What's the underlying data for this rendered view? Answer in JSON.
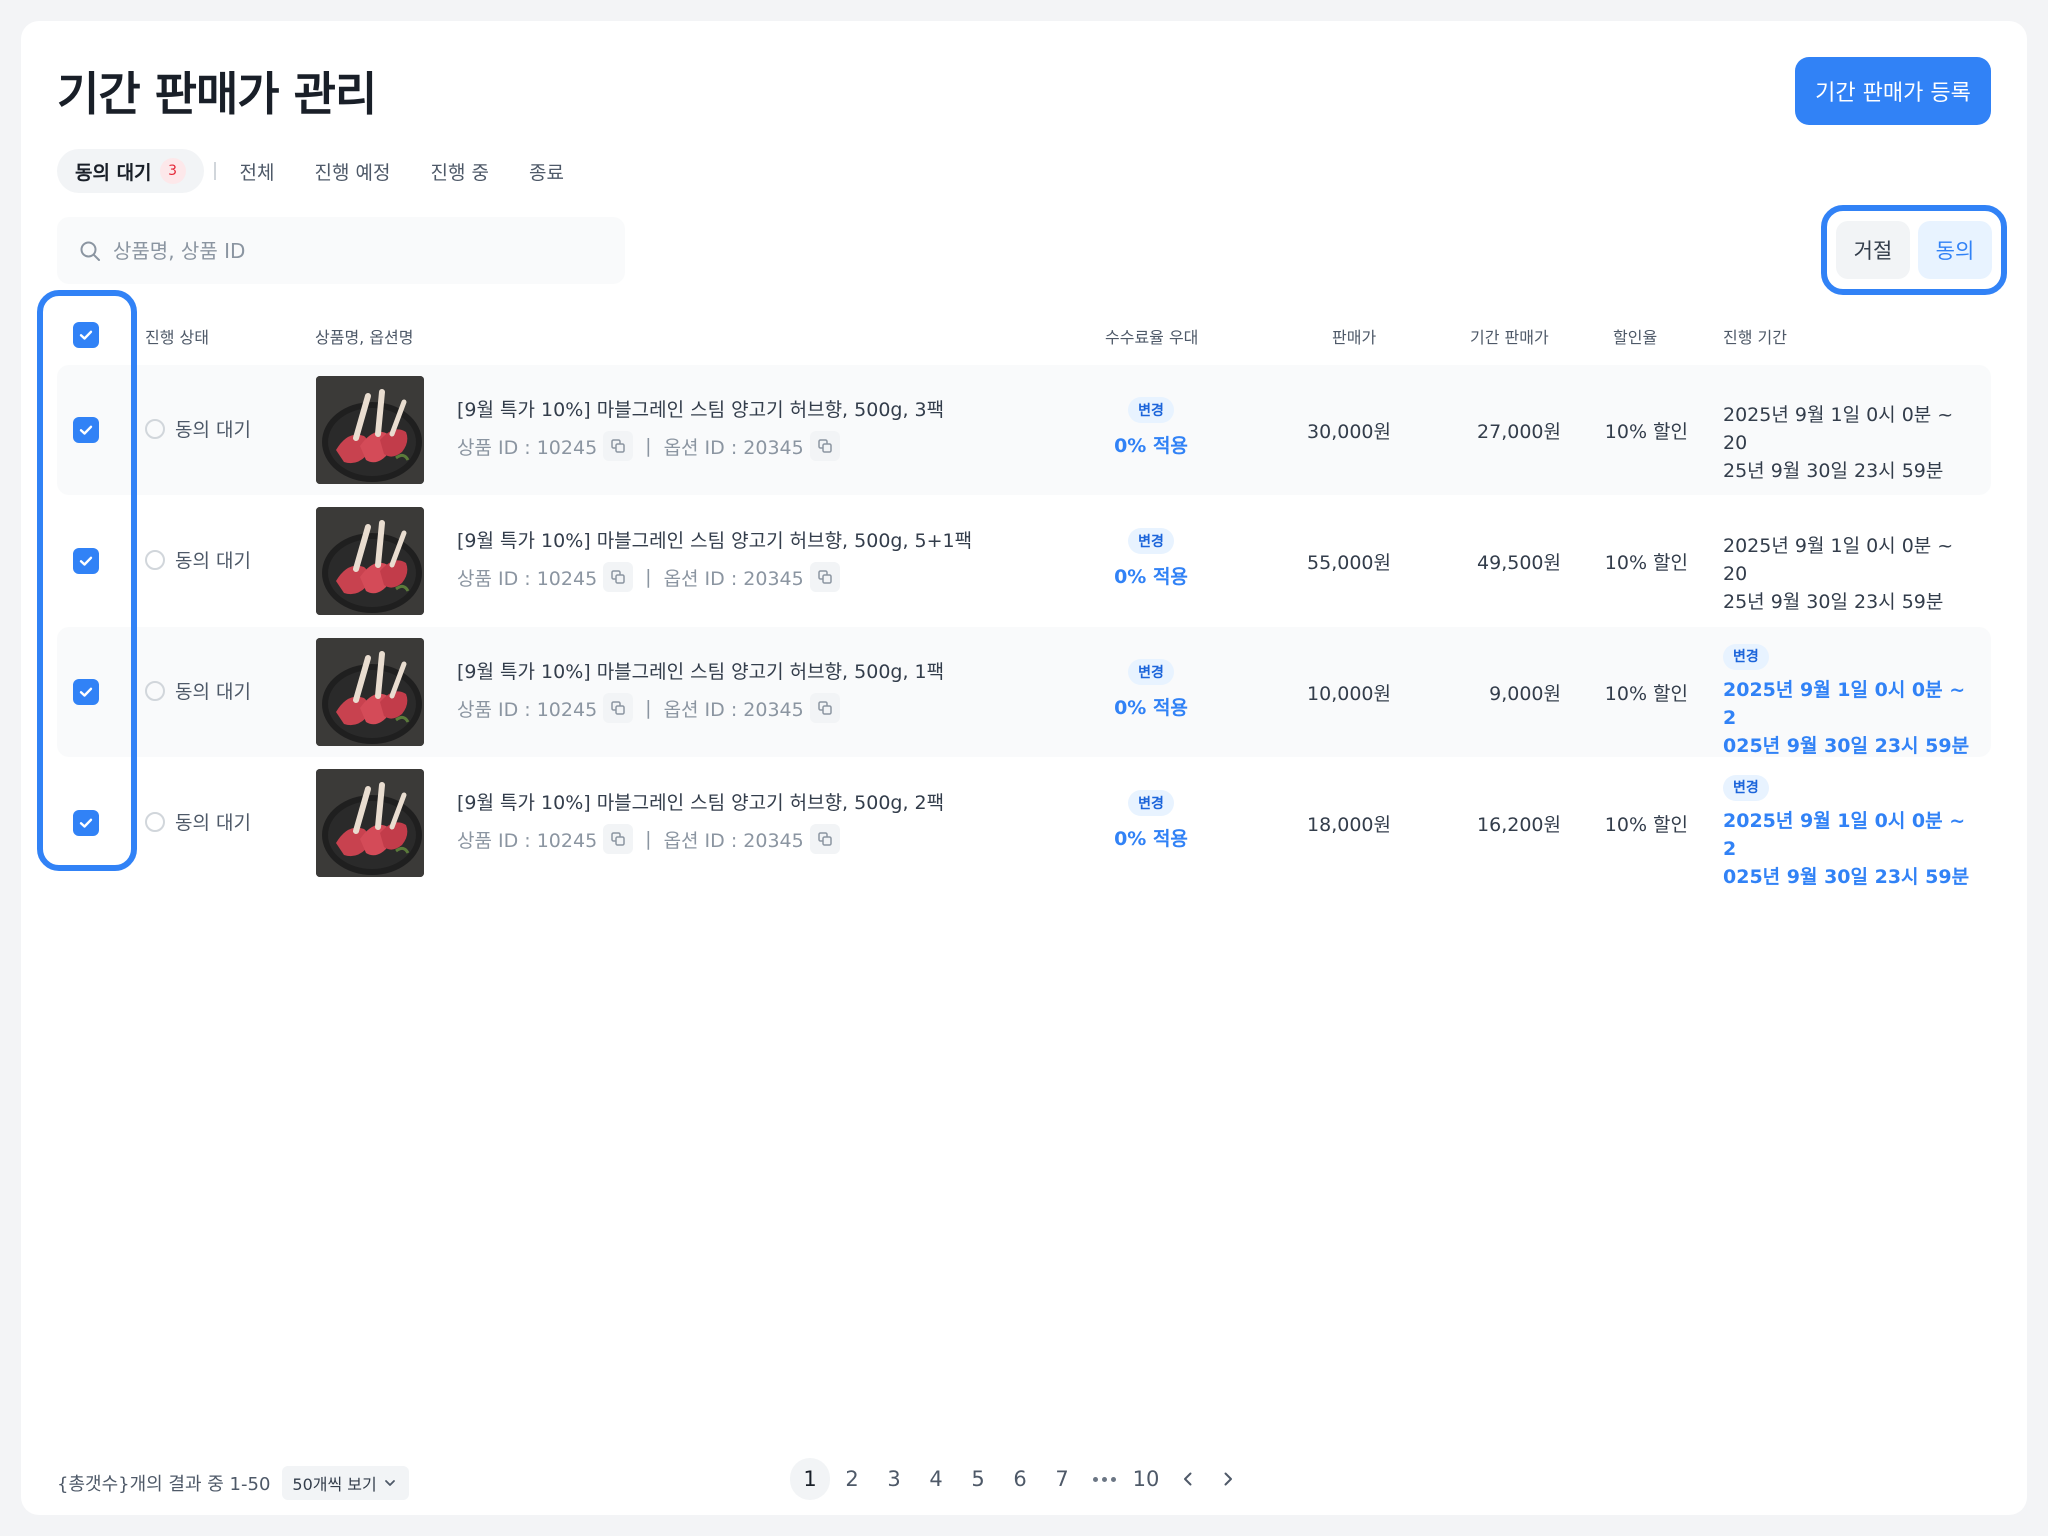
{
  "header": {
    "title": "기간 판매가 관리",
    "register_label": "기간 판매가 등록"
  },
  "tabs": [
    {
      "label": "동의 대기",
      "badge": "3",
      "active": true
    },
    {
      "label": "전체"
    },
    {
      "label": "진행 예정"
    },
    {
      "label": "진행 중"
    },
    {
      "label": "종료"
    }
  ],
  "search": {
    "placeholder": "상품명, 상품 ID",
    "value": ""
  },
  "actions": {
    "reject_label": "거절",
    "agree_label": "동의"
  },
  "table": {
    "headers": {
      "status": "진행 상태",
      "product": "상품명, 옵션명",
      "fee": "수수료율 우대",
      "price": "판매가",
      "period_price": "기간 판매가",
      "discount": "할인율",
      "period": "진행 기간"
    },
    "rows": [
      {
        "checked": true,
        "status": "동의 대기",
        "name": "[9월 특가 10%] 마블그레인 스팀 양고기 허브향, 500g, 3팩",
        "product_id": "상품 ID : 10245",
        "option_id": "옵션 ID : 20345",
        "fee_badge": "변경",
        "fee_value": "0% 적용",
        "price": "30,000원",
        "period_price": "27,000원",
        "discount": "10% 할인",
        "period_line1": "2025년 9월 1일 0시 0분 ~ 20",
        "period_line2": "25년 9월 30일 23시 59분",
        "period_changed": false
      },
      {
        "checked": true,
        "status": "동의 대기",
        "name": "[9월 특가 10%] 마블그레인 스팀 양고기 허브향, 500g, 5+1팩",
        "product_id": "상품 ID : 10245",
        "option_id": "옵션 ID : 20345",
        "fee_badge": "변경",
        "fee_value": "0% 적용",
        "price": "55,000원",
        "period_price": "49,500원",
        "discount": "10% 할인",
        "period_line1": "2025년 9월 1일 0시 0분 ~ 20",
        "period_line2": "25년 9월 30일 23시 59분",
        "period_changed": false
      },
      {
        "checked": true,
        "status": "동의 대기",
        "name": "[9월 특가 10%] 마블그레인 스팀 양고기 허브향, 500g, 1팩",
        "product_id": "상품 ID : 10245",
        "option_id": "옵션 ID : 20345",
        "fee_badge": "변경",
        "fee_value": "0% 적용",
        "price": "10,000원",
        "period_price": "9,000원",
        "discount": "10% 할인",
        "period_badge": "변경",
        "period_line1": "2025년 9월 1일 0시 0분 ~ 2",
        "period_line2": "025년 9월 30일 23시 59분",
        "period_changed": true
      },
      {
        "checked": true,
        "status": "동의 대기",
        "name": "[9월 특가 10%] 마블그레인 스팀 양고기 허브향, 500g, 2팩",
        "product_id": "상품 ID : 10245",
        "option_id": "옵션 ID : 20345",
        "fee_badge": "변경",
        "fee_value": "0% 적용",
        "price": "18,000원",
        "period_price": "16,200원",
        "discount": "10% 할인",
        "period_badge": "변경",
        "period_line1": "2025년 9월 1일 0시 0분 ~ 2",
        "period_line2": "025년 9월 30일 23시 59분",
        "period_changed": true
      }
    ]
  },
  "footer": {
    "summary": "{총갯수}개의 결과 중 1-50",
    "per_page": "50개씩 보기",
    "pages": [
      "1",
      "2",
      "3",
      "4",
      "5",
      "6",
      "7"
    ],
    "last_page": "10",
    "current_page": "1"
  },
  "colors": {
    "accent": "#3182f6",
    "badge_red": "#e42939"
  },
  "icons": {
    "search": "search-icon",
    "copy": "copy-icon",
    "prev": "chevron-left-icon",
    "next": "chevron-right-icon",
    "dropdown": "chevron-down-icon"
  }
}
